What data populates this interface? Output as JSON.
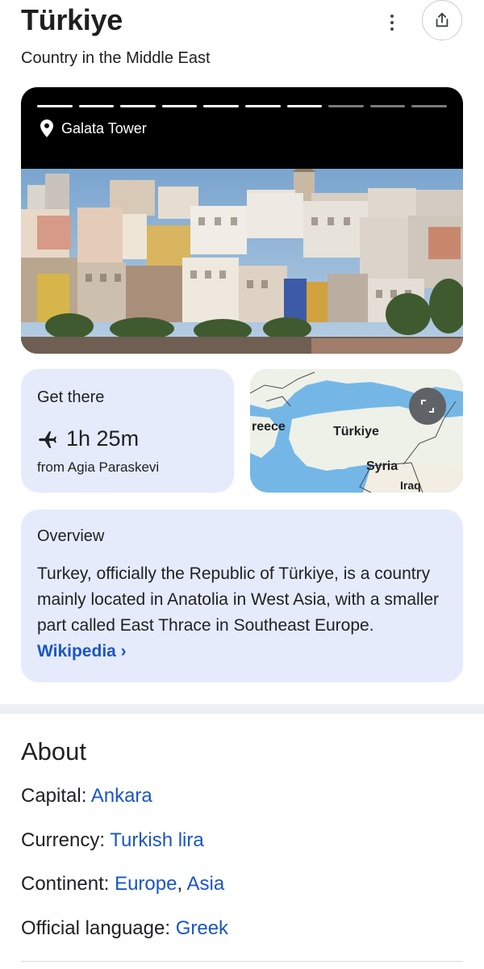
{
  "header": {
    "title": "Türkiye",
    "subtitle": "Country in the Middle East",
    "more_icon": "more-vert-icon",
    "share_icon": "share-icon"
  },
  "hero": {
    "location_icon": "pin-icon",
    "location": "Galata Tower",
    "progress": {
      "segments": 10,
      "completed": 7
    }
  },
  "get_there": {
    "title": "Get there",
    "icon": "airplane-icon",
    "duration": "1h 25m",
    "from": "from Agia Paraskevi"
  },
  "map": {
    "labels": [
      "reece",
      "Türkiye",
      "Syria",
      "Iraq"
    ],
    "expand_icon": "expand-icon"
  },
  "overview": {
    "title": "Overview",
    "text": "Turkey, officially the Republic of Türkiye, is a country mainly located in Anatolia in West Asia, with a smaller part called East Thrace in Southeast Europe. ",
    "link": "Wikipedia ›"
  },
  "about": {
    "title": "About",
    "capital_label": "Capital: ",
    "capital_value": "Ankara",
    "currency_label": "Currency: ",
    "currency_value": "Turkish lira",
    "continent_label": "Continent: ",
    "continent_value_1": "Europe",
    "continent_sep": ", ",
    "continent_value_2": "Asia",
    "language_label": "Official language: ",
    "language_value": "Greek"
  },
  "colors": {
    "card_bg": "#e5ebfb",
    "link": "#1a56c4",
    "map_water": "#74b7e7",
    "map_land": "#eef1e8"
  }
}
